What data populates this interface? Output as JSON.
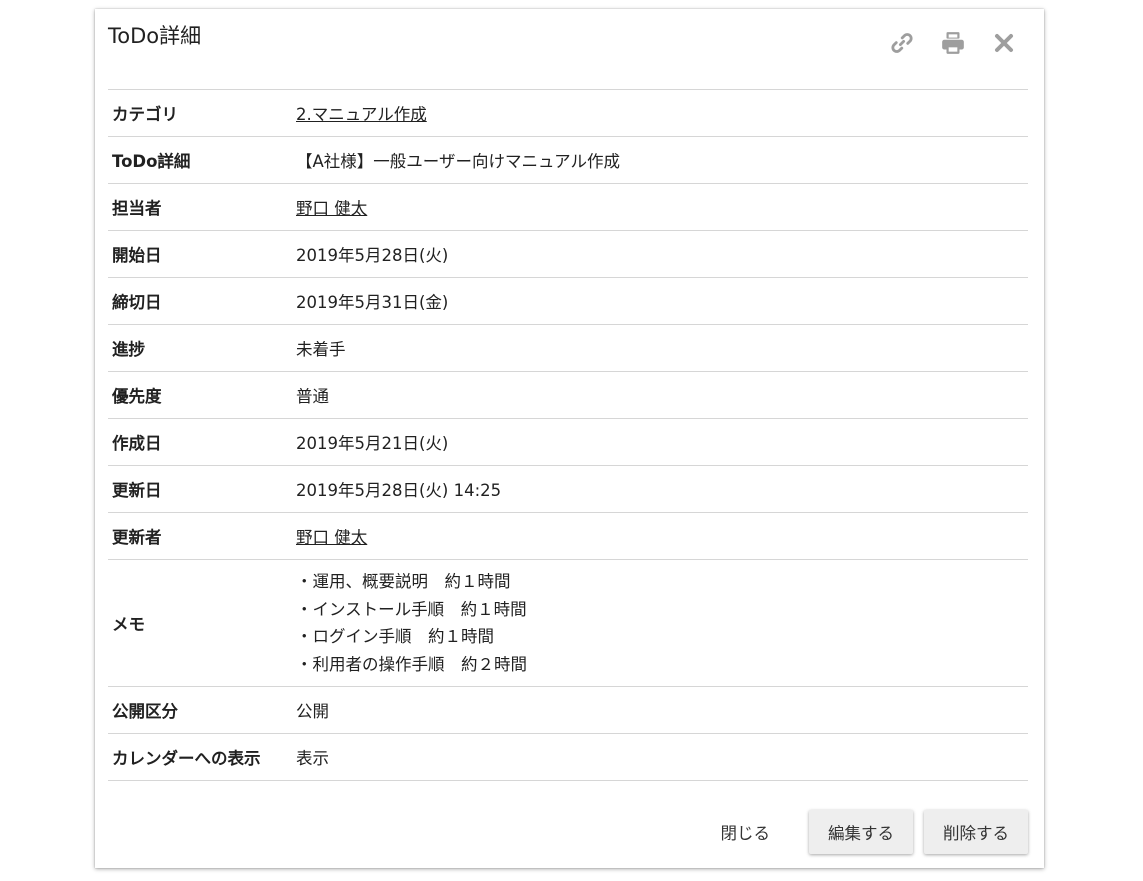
{
  "dialog": {
    "title": "ToDo詳細",
    "icons": [
      "link-icon",
      "print-icon",
      "close-icon"
    ]
  },
  "rows": [
    {
      "label": "カテゴリ",
      "value": "2.マニュアル作成",
      "link": true
    },
    {
      "label": "ToDo詳細",
      "value": "【A社様】一般ユーザー向けマニュアル作成",
      "link": false
    },
    {
      "label": "担当者",
      "value": "野口 健太",
      "link": true
    },
    {
      "label": "開始日",
      "value": "2019年5月28日(火)",
      "link": false
    },
    {
      "label": "締切日",
      "value": "2019年5月31日(金)",
      "link": false
    },
    {
      "label": "進捗",
      "value": "未着手",
      "link": false
    },
    {
      "label": "優先度",
      "value": "普通",
      "link": false
    },
    {
      "label": "作成日",
      "value": "2019年5月21日(火)",
      "link": false
    },
    {
      "label": "更新日",
      "value": "2019年5月28日(火) 14:25",
      "link": false
    },
    {
      "label": "更新者",
      "value": "野口 健太",
      "link": true
    }
  ],
  "memo": {
    "label": "メモ",
    "lines": [
      "・運用、概要説明　約１時間",
      "・インストール手順　約１時間",
      "・ログイン手順　約１時間",
      "・利用者の操作手順　約２時間"
    ]
  },
  "rows_after": [
    {
      "label": "公開区分",
      "value": "公開"
    },
    {
      "label": "カレンダーへの表示",
      "value": "表示"
    }
  ],
  "actions": {
    "close_label": "閉じる",
    "edit_label": "編集する",
    "delete_label": "削除する"
  },
  "colors": {
    "icon": "#9e9e9e",
    "divider": "#d6d6d6",
    "button_bg": "#eeeeee"
  }
}
